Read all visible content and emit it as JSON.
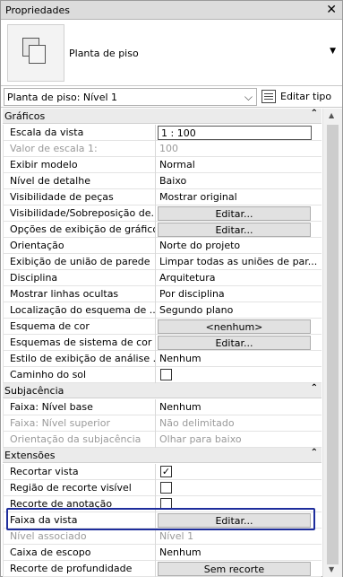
{
  "window": {
    "title": "Propriedades"
  },
  "type_selector": {
    "name": "Planta de piso"
  },
  "filter": {
    "value": "Planta de piso: Nível 1",
    "edit_type_label": "Editar tipo"
  },
  "sections": [
    {
      "title": "Gráficos",
      "rows": [
        {
          "label": "Escala da vista",
          "value": "1 : 100",
          "kind": "field"
        },
        {
          "label": "Valor de escala    1:",
          "value": "100",
          "kind": "text",
          "disabled": true
        },
        {
          "label": "Exibir modelo",
          "value": "Normal",
          "kind": "text"
        },
        {
          "label": "Nível de detalhe",
          "value": "Baixo",
          "kind": "text"
        },
        {
          "label": "Visibilidade de peças",
          "value": "Mostrar original",
          "kind": "text"
        },
        {
          "label": "Visibilidade/Sobreposição de...",
          "value": "Editar...",
          "kind": "button"
        },
        {
          "label": "Opções de exibição de gráficos",
          "value": "Editar...",
          "kind": "button"
        },
        {
          "label": "Orientação",
          "value": "Norte do projeto",
          "kind": "text"
        },
        {
          "label": "Exibição de união de parede",
          "value": "Limpar todas as uniões de par...",
          "kind": "text"
        },
        {
          "label": "Disciplina",
          "value": "Arquitetura",
          "kind": "text"
        },
        {
          "label": "Mostrar linhas ocultas",
          "value": "Por disciplina",
          "kind": "text"
        },
        {
          "label": "Localização do esquema de ...",
          "value": "Segundo plano",
          "kind": "text"
        },
        {
          "label": "Esquema de cor",
          "value": "<nenhum>",
          "kind": "button"
        },
        {
          "label": "Esquemas de sistema de cor",
          "value": "Editar...",
          "kind": "button"
        },
        {
          "label": "Estilo de exibição de análise ...",
          "value": "Nenhum",
          "kind": "text"
        },
        {
          "label": "Caminho do sol",
          "value": "",
          "kind": "checkbox",
          "checked": false
        }
      ]
    },
    {
      "title": "Subjacência",
      "rows": [
        {
          "label": "Faixa: Nível base",
          "value": "Nenhum",
          "kind": "text"
        },
        {
          "label": "Faixa: Nível superior",
          "value": "Não delimitado",
          "kind": "text",
          "disabled": true
        },
        {
          "label": "Orientação da subjacência",
          "value": "Olhar para baixo",
          "kind": "text",
          "disabled": true
        }
      ]
    },
    {
      "title": "Extensões",
      "rows": [
        {
          "label": "Recortar vista",
          "value": "",
          "kind": "checkbox",
          "checked": true
        },
        {
          "label": "Região de recorte visível",
          "value": "",
          "kind": "checkbox",
          "checked": false
        },
        {
          "label": "Recorte de anotação",
          "value": "",
          "kind": "checkbox",
          "checked": false
        },
        {
          "label": "Faixa da vista",
          "value": "Editar...",
          "kind": "button"
        },
        {
          "label": "Nível associado",
          "value": "Nível 1",
          "kind": "text",
          "disabled": true
        },
        {
          "label": "Caixa de escopo",
          "value": "Nenhum",
          "kind": "text"
        },
        {
          "label": "Recorte de profundidade",
          "value": "Sem recorte",
          "kind": "button"
        }
      ]
    }
  ],
  "icons": {
    "close": "close-icon",
    "collapse": "chevron-up-icon",
    "dropdown": "chevron-down-icon"
  },
  "colors": {
    "highlight": "#1e2d9c",
    "section_bg": "#ebebeb"
  }
}
